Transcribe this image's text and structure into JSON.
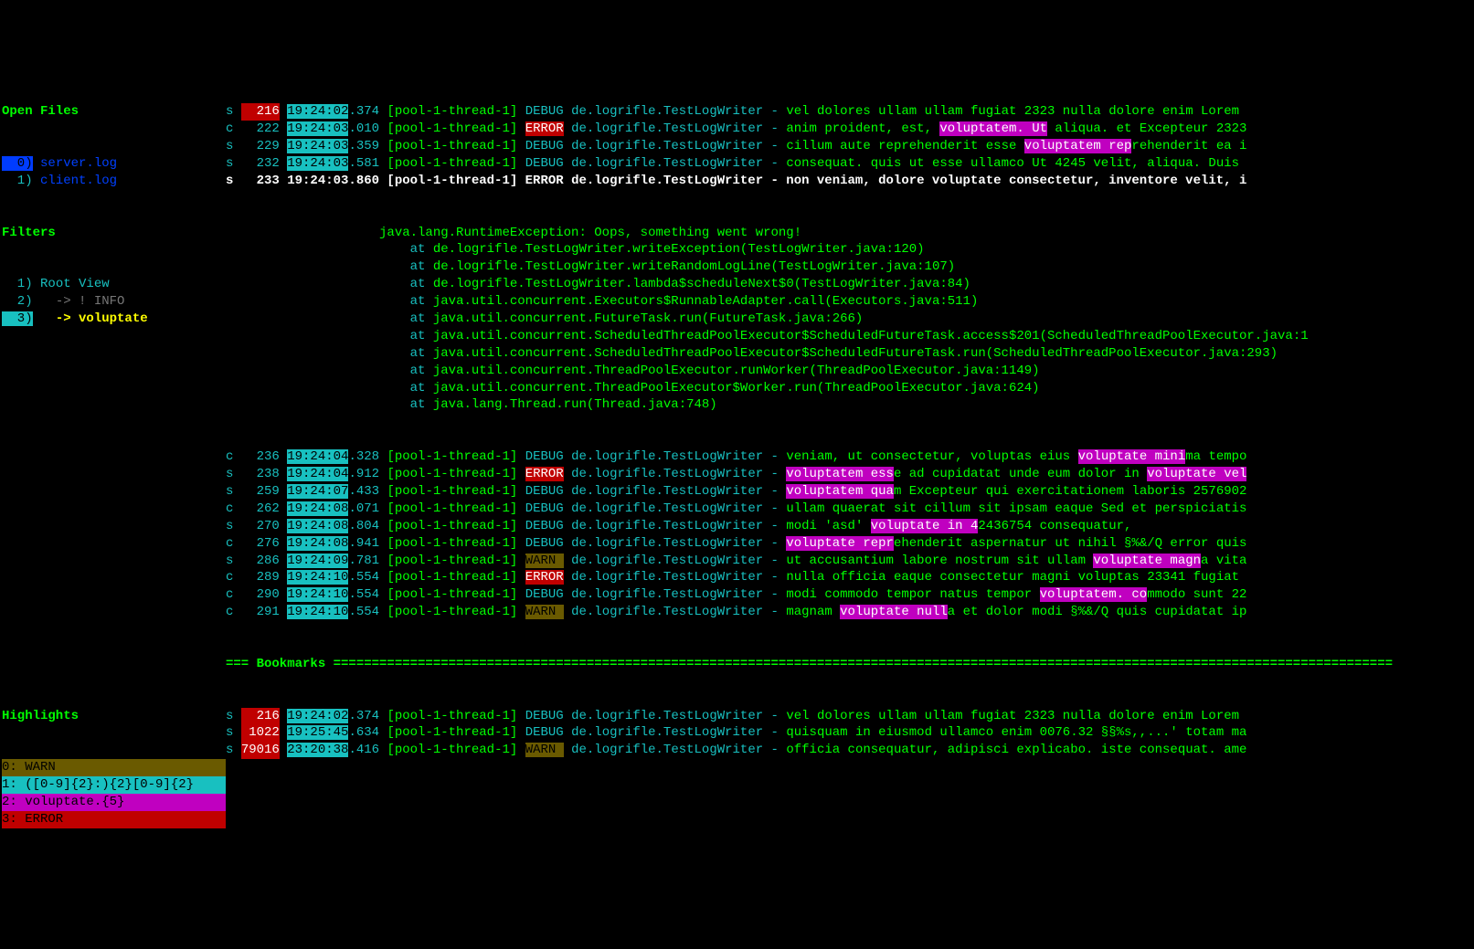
{
  "sidebar": {
    "open_files_heading": "Open Files",
    "files": [
      {
        "idx": "0)",
        "selected": true,
        "name": "server.log"
      },
      {
        "idx": "1)",
        "selected": false,
        "name": "client.log"
      }
    ],
    "filters_heading": "Filters",
    "filters": [
      {
        "idx": "1)",
        "label": " Root View",
        "kind": "root"
      },
      {
        "idx": "2)",
        "label": "   -> ! INFO",
        "kind": "dim"
      },
      {
        "idx": "3)",
        "label": "   -> voluptate",
        "kind": "sel"
      }
    ],
    "highlights_heading": "Highlights",
    "highlights": [
      {
        "idx": "0:",
        "text": " WARN",
        "cls": "hl0"
      },
      {
        "idx": "1:",
        "text": " ([0-9]{2}:){2}[0-9]{2}",
        "cls": "hl1"
      },
      {
        "idx": "2:",
        "text": " voluptate.{5}",
        "cls": "hl2"
      },
      {
        "idx": "3:",
        "text": " ERROR",
        "cls": "hl3"
      }
    ]
  },
  "log": {
    "main_rows": [
      {
        "m": "s",
        "nred": true,
        "n": "216",
        "ts": "19:24:02",
        "ms": ".374",
        "thr": " [pool-1-thread-1] ",
        "lvl": "DEBUG",
        "lvlcls": "lvl-d",
        "logger": " de.logrifle.TestLogWriter - ",
        "before": "vel dolores ullam ullam fugiat 2323 nulla dolore enim Lorem",
        "match": "",
        "after": ""
      },
      {
        "m": "c",
        "n": "222",
        "ts": "19:24:03",
        "ms": ".010",
        "thr": " [pool-1-thread-1] ",
        "lvl": "ERROR",
        "lvlcls": "lvl-e",
        "logger": " de.logrifle.TestLogWriter - ",
        "before": "anim proident, est, ",
        "match": "voluptatem. Ut",
        "after": " aliqua. et Excepteur 2323"
      },
      {
        "m": "s",
        "n": "229",
        "ts": "19:24:03",
        "ms": ".359",
        "thr": " [pool-1-thread-1] ",
        "lvl": "DEBUG",
        "lvlcls": "lvl-d",
        "logger": " de.logrifle.TestLogWriter - ",
        "before": "cillum aute reprehenderit esse ",
        "match": "voluptatem rep",
        "after": "rehenderit ea i"
      },
      {
        "m": "s",
        "n": "232",
        "ts": "19:24:03",
        "ms": ".581",
        "thr": " [pool-1-thread-1] ",
        "lvl": "DEBUG",
        "lvlcls": "lvl-d",
        "logger": " de.logrifle.TestLogWriter - ",
        "before": "consequat. quis ut esse ullamco Ut 4245 velit, aliqua. Duis",
        "match": "",
        "after": ""
      },
      {
        "cur": true,
        "m": "s",
        "n": "233",
        "full": "19:24:03.860 [pool-1-thread-1] ERROR de.logrifle.TestLogWriter - non veniam, dolore voluptate consectetur, inventore velit, i"
      }
    ],
    "exception_head": "            java.lang.RuntimeException: Oops, something went wrong!",
    "stack": [
      "                at de.logrifle.TestLogWriter.writeException(TestLogWriter.java:120)",
      "                at de.logrifle.TestLogWriter.writeRandomLogLine(TestLogWriter.java:107)",
      "                at de.logrifle.TestLogWriter.lambda$scheduleNext$0(TestLogWriter.java:84)",
      "                at java.util.concurrent.Executors$RunnableAdapter.call(Executors.java:511)",
      "                at java.util.concurrent.FutureTask.run(FutureTask.java:266)",
      "                at java.util.concurrent.ScheduledThreadPoolExecutor$ScheduledFutureTask.access$201(ScheduledThreadPoolExecutor.java:1",
      "                at java.util.concurrent.ScheduledThreadPoolExecutor$ScheduledFutureTask.run(ScheduledThreadPoolExecutor.java:293)",
      "                at java.util.concurrent.ThreadPoolExecutor.runWorker(ThreadPoolExecutor.java:1149)",
      "                at java.util.concurrent.ThreadPoolExecutor$Worker.run(ThreadPoolExecutor.java:624)",
      "                at java.lang.Thread.run(Thread.java:748)"
    ],
    "after_rows": [
      {
        "m": "c",
        "n": "236",
        "ts": "19:24:04",
        "ms": ".328",
        "thr": " [pool-1-thread-1] ",
        "lvl": "DEBUG",
        "lvlcls": "lvl-d",
        "logger": " de.logrifle.TestLogWriter - ",
        "before": "veniam, ut consectetur, voluptas eius ",
        "match": "voluptate mini",
        "after": "ma tempo"
      },
      {
        "m": "s",
        "n": "238",
        "ts": "19:24:04",
        "ms": ".912",
        "thr": " [pool-1-thread-1] ",
        "lvl": "ERROR",
        "lvlcls": "lvl-e",
        "logger": " de.logrifle.TestLogWriter - ",
        "before": "",
        "match": "voluptatem ess",
        "after": "e ad cupidatat unde eum dolor in ",
        "match2": "voluptate vel"
      },
      {
        "m": "s",
        "n": "259",
        "ts": "19:24:07",
        "ms": ".433",
        "thr": " [pool-1-thread-1] ",
        "lvl": "DEBUG",
        "lvlcls": "lvl-d",
        "logger": " de.logrifle.TestLogWriter - ",
        "before": "",
        "match": "voluptatem qua",
        "after": "m Excepteur qui exercitationem laboris 2576902"
      },
      {
        "m": "c",
        "n": "262",
        "ts": "19:24:08",
        "ms": ".071",
        "thr": " [pool-1-thread-1] ",
        "lvl": "DEBUG",
        "lvlcls": "lvl-d",
        "logger": " de.logrifle.TestLogWriter - ",
        "before": "ullam quaerat sit cillum sit ipsam eaque Sed et perspiciatis",
        "match": "",
        "after": ""
      },
      {
        "m": "s",
        "n": "270",
        "ts": "19:24:08",
        "ms": ".804",
        "thr": " [pool-1-thread-1] ",
        "lvl": "DEBUG",
        "lvlcls": "lvl-d",
        "logger": " de.logrifle.TestLogWriter - ",
        "before": "modi 'asd' ",
        "match": "voluptate in 4",
        "after": "2436754 consequatur,"
      },
      {
        "m": "c",
        "n": "276",
        "ts": "19:24:08",
        "ms": ".941",
        "thr": " [pool-1-thread-1] ",
        "lvl": "DEBUG",
        "lvlcls": "lvl-d",
        "logger": " de.logrifle.TestLogWriter - ",
        "before": "",
        "match": "voluptate repr",
        "after": "ehenderit aspernatur ut nihil §%&/Q error quis"
      },
      {
        "m": "s",
        "n": "286",
        "ts": "19:24:09",
        "ms": ".781",
        "thr": " [pool-1-thread-1] ",
        "lvl": "WARN ",
        "lvlcls": "lvl-w",
        "logger": " de.logrifle.TestLogWriter - ",
        "before": "ut accusantium labore nostrum sit ullam ",
        "match": "voluptate magn",
        "after": "a vita"
      },
      {
        "m": "c",
        "n": "289",
        "ts": "19:24:10",
        "ms": ".554",
        "thr": " [pool-1-thread-1] ",
        "lvl": "ERROR",
        "lvlcls": "lvl-e",
        "logger": " de.logrifle.TestLogWriter - ",
        "before": "nulla officia eaque consectetur magni voluptas 23341 fugiat",
        "match": "",
        "after": ""
      },
      {
        "m": "c",
        "n": "290",
        "ts": "19:24:10",
        "ms": ".554",
        "thr": " [pool-1-thread-1] ",
        "lvl": "DEBUG",
        "lvlcls": "lvl-d",
        "logger": " de.logrifle.TestLogWriter - ",
        "before": "modi commodo tempor natus tempor ",
        "match": "voluptatem. co",
        "after": "mmodo sunt 22"
      },
      {
        "m": "c",
        "n": "291",
        "ts": "19:24:10",
        "ms": ".554",
        "thr": " [pool-1-thread-1] ",
        "lvl": "WARN ",
        "lvlcls": "lvl-w",
        "logger": " de.logrifle.TestLogWriter - ",
        "before": "magnam ",
        "match": "voluptate null",
        "after": "a et dolor modi §%&/Q quis cupidatat ip"
      }
    ],
    "bookmarks_heading": "=== Bookmarks ==========================================================================================================================================",
    "bookmark_rows": [
      {
        "m": "s",
        "nred": true,
        "n": "216",
        "ts": "19:24:02",
        "ms": ".374",
        "thr": " [pool-1-thread-1] ",
        "lvl": "DEBUG",
        "lvlcls": "lvl-d",
        "logger": " de.logrifle.TestLogWriter - ",
        "before": "vel dolores ullam ullam fugiat 2323 nulla dolore enim Lorem",
        "match": "",
        "after": ""
      },
      {
        "m": "s",
        "nred": true,
        "n": "1022",
        "ts": "19:25:45",
        "ms": ".634",
        "thr": " [pool-1-thread-1] ",
        "lvl": "DEBUG",
        "lvlcls": "lvl-d",
        "logger": " de.logrifle.TestLogWriter - ",
        "before": "quisquam in eiusmod ullamco enim 0076.32 §§%s,,...' totam ma",
        "match": "",
        "after": ""
      },
      {
        "m": "s",
        "nred": true,
        "n": "79016",
        "ts": "23:20:38",
        "ms": ".416",
        "thr": " [pool-1-thread-1] ",
        "lvl": "WARN ",
        "lvlcls": "lvl-w",
        "logger": " de.logrifle.TestLogWriter - ",
        "before": "officia consequatur, adipisci explicabo. iste consequat. ame",
        "match": "",
        "after": ""
      }
    ]
  }
}
